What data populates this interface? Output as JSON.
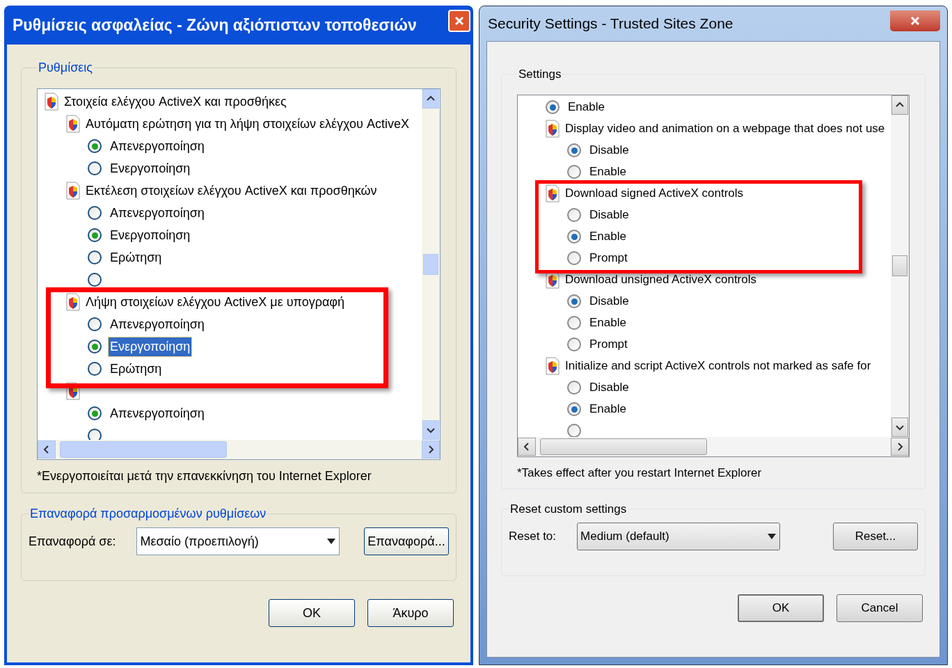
{
  "dialogs": [
    {
      "kind": "xp",
      "title": "Ρυθμίσεις ασφαλείας - Ζώνη αξιόπιστων τοποθεσιών",
      "settings": {
        "legend": "Ρυθμίσεις",
        "items": [
          {
            "kind": "setting",
            "label": "Στοιχεία ελέγχου ActiveX και προσθήκες",
            "children": [
              {
                "kind": "setting",
                "label": "Αυτόματη ερώτηση για τη λήψη στοιχείων ελέγχου ActiveX",
                "children": [
                  {
                    "kind": "option",
                    "label": "Απενεργοποίηση",
                    "selected": true,
                    "focused": false
                  },
                  {
                    "kind": "option",
                    "label": "Ενεργοποίηση",
                    "selected": false,
                    "focused": false
                  }
                ]
              },
              {
                "kind": "setting",
                "label": "Εκτέλεση στοιχείων ελέγχου ActiveX και προσθηκών",
                "children": [
                  {
                    "kind": "option",
                    "label": "Απενεργοποίηση",
                    "selected": false,
                    "focused": false
                  },
                  {
                    "kind": "option",
                    "label": "Ενεργοποίηση",
                    "selected": true,
                    "focused": false
                  },
                  {
                    "kind": "option",
                    "label": "Ερώτηση",
                    "selected": false,
                    "focused": false
                  },
                  {
                    "kind": "option",
                    "selected": false
                  }
                ]
              },
              {
                "kind": "setting",
                "label": "Λήψη στοιχείων ελέγχου ActiveX με υπογραφή",
                "children": [
                  {
                    "kind": "option",
                    "label": "Απενεργοποίηση",
                    "selected": false,
                    "focused": false
                  },
                  {
                    "kind": "option",
                    "label": "Ενεργοποίηση",
                    "selected": true,
                    "focused": true
                  },
                  {
                    "kind": "option",
                    "label": "Ερώτηση",
                    "selected": false,
                    "focused": false
                  }
                ]
              },
              {
                "kind": "setting",
                "children": [
                  {
                    "kind": "option",
                    "label": "Απενεργοποίηση",
                    "selected": true,
                    "focused": false
                  },
                  {
                    "kind": "option",
                    "selected": false
                  }
                ]
              }
            ]
          }
        ],
        "note": "*Ενεργοποιείται μετά την επανεκκίνηση του Internet Explorer"
      },
      "reset": {
        "legend": "Επαναφορά προσαρμοσμένων ρυθμίσεων",
        "label": "Επαναφορά σε:",
        "value": "Μεσαίο (προεπιλογή)",
        "button": "Επαναφορά..."
      },
      "buttons": [
        {
          "label": "OK",
          "default": false
        },
        {
          "label": "Άκυρο",
          "default": false
        }
      ]
    },
    {
      "kind": "aero",
      "title": "Security Settings - Trusted Sites Zone",
      "settings": {
        "legend": "Settings",
        "items": [
          {
            "kind": "option",
            "label": "Enable",
            "selected": true,
            "focused": false
          },
          {
            "kind": "setting",
            "label": "Display video and animation on a webpage that does not use",
            "children": [
              {
                "kind": "option",
                "label": "Disable",
                "selected": true,
                "focused": false
              },
              {
                "kind": "option",
                "label": "Enable",
                "selected": false,
                "focused": false
              }
            ]
          },
          {
            "kind": "setting",
            "label": "Download signed ActiveX controls",
            "children": [
              {
                "kind": "option",
                "label": "Disable",
                "selected": false,
                "focused": false
              },
              {
                "kind": "option",
                "label": "Enable",
                "selected": true,
                "focused": false
              },
              {
                "kind": "option",
                "label": "Prompt",
                "selected": false,
                "focused": false
              }
            ]
          },
          {
            "kind": "setting",
            "label": "Download unsigned ActiveX controls",
            "children": [
              {
                "kind": "option",
                "label": "Disable",
                "selected": true,
                "focused": false
              },
              {
                "kind": "option",
                "label": "Enable",
                "selected": false,
                "focused": false
              },
              {
                "kind": "option",
                "label": "Prompt",
                "selected": false,
                "focused": false
              }
            ]
          },
          {
            "kind": "setting",
            "label": "Initialize and script ActiveX controls not marked as safe for",
            "children": [
              {
                "kind": "option",
                "label": "Disable",
                "selected": false,
                "focused": false
              },
              {
                "kind": "option",
                "label": "Enable",
                "selected": true,
                "focused": false
              },
              {
                "kind": "option",
                "selected": false
              }
            ]
          }
        ],
        "note": "*Takes effect after you restart Internet Explorer"
      },
      "reset": {
        "legend": "Reset custom settings",
        "label": "Reset to:",
        "value": "Medium (default)",
        "button": "Reset..."
      },
      "buttons": [
        {
          "label": "OK",
          "default": true
        },
        {
          "label": "Cancel",
          "default": false
        }
      ]
    }
  ]
}
